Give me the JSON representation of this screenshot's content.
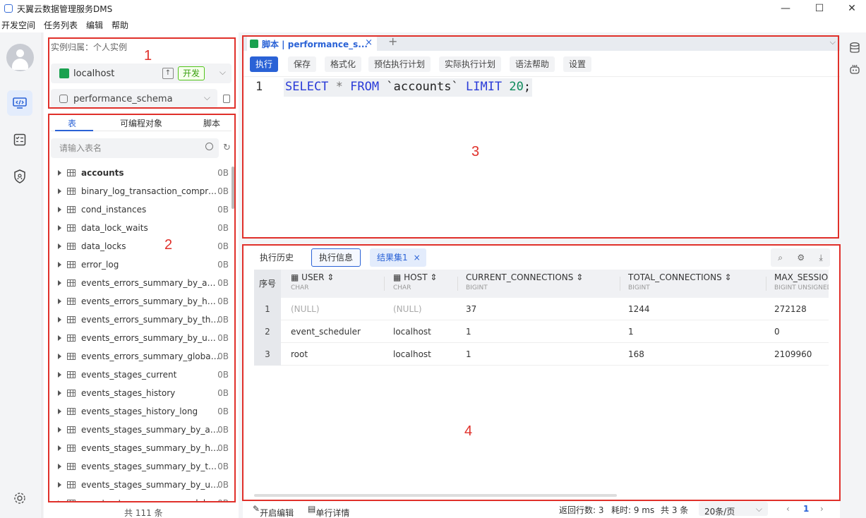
{
  "window": {
    "title": "天翼云数据管理服务DMS",
    "minimize": "—",
    "maximize": "☐",
    "close": "✕"
  },
  "menu": [
    "开发空间",
    "任务列表",
    "编辑",
    "帮助"
  ],
  "sidebar": {
    "instance_label": "实例归属：个人实例",
    "connection": {
      "name": "localhost",
      "env_tag": "开发"
    },
    "database": "performance_schema",
    "tabs": [
      "表",
      "可编程对象",
      "脚本"
    ],
    "active_tab": "表",
    "search_placeholder": "请输入表名",
    "tables": [
      {
        "name": "accounts",
        "size": "0B",
        "bold": true
      },
      {
        "name": "binary_log_transaction_compression_stats",
        "size": "0B"
      },
      {
        "name": "cond_instances",
        "size": "0B"
      },
      {
        "name": "data_lock_waits",
        "size": "0B"
      },
      {
        "name": "data_locks",
        "size": "0B"
      },
      {
        "name": "error_log",
        "size": "0B"
      },
      {
        "name": "events_errors_summary_by_account_by_error",
        "size": "0B"
      },
      {
        "name": "events_errors_summary_by_host_by_error",
        "size": "0B"
      },
      {
        "name": "events_errors_summary_by_thread_by_error",
        "size": "0B"
      },
      {
        "name": "events_errors_summary_by_user_by_error",
        "size": "0B"
      },
      {
        "name": "events_errors_summary_global_by_error",
        "size": "0B"
      },
      {
        "name": "events_stages_current",
        "size": "0B"
      },
      {
        "name": "events_stages_history",
        "size": "0B"
      },
      {
        "name": "events_stages_history_long",
        "size": "0B"
      },
      {
        "name": "events_stages_summary_by_account_by_event_name",
        "size": "0B"
      },
      {
        "name": "events_stages_summary_by_host_by_event_name",
        "size": "0B"
      },
      {
        "name": "events_stages_summary_by_thread_by_event_name",
        "size": "0B"
      },
      {
        "name": "events_stages_summary_by_user_by_event_name",
        "size": "0B"
      },
      {
        "name": "events_stages_summary_global_by_event_name",
        "size": "0B"
      }
    ],
    "total": "共 111 条"
  },
  "editor": {
    "tab_label": "脚本 | performance_s...",
    "toolbar": [
      "执行",
      "保存",
      "格式化",
      "预估执行计划",
      "实际执行计划",
      "语法帮助",
      "设置"
    ],
    "line_no": "1",
    "code": {
      "kw1": "SELECT",
      "star": "*",
      "kw2": "FROM",
      "table": "`accounts`",
      "kw3": "LIMIT",
      "num": "20",
      "end": ";"
    }
  },
  "results": {
    "tabs": [
      "执行历史",
      "执行信息",
      "结果集1"
    ],
    "seq_header": "序号",
    "columns": [
      {
        "name": "USER",
        "type": "CHAR"
      },
      {
        "name": "HOST",
        "type": "CHAR"
      },
      {
        "name": "CURRENT_CONNECTIONS",
        "type": "BIGINT"
      },
      {
        "name": "TOTAL_CONNECTIONS",
        "type": "BIGINT"
      },
      {
        "name": "MAX_SESSION",
        "type": "BIGINT UNSIGNED"
      }
    ],
    "rows": [
      {
        "idx": "1",
        "cells": [
          "(NULL)",
          "(NULL)",
          "37",
          "1244",
          "272128"
        ]
      },
      {
        "idx": "2",
        "cells": [
          "event_scheduler",
          "localhost",
          "1",
          "1",
          "0"
        ]
      },
      {
        "idx": "3",
        "cells": [
          "root",
          "localhost",
          "1",
          "168",
          "2109960"
        ]
      }
    ]
  },
  "status": {
    "open_edit": "开启编辑",
    "row_detail": "单行详情",
    "rows_returned": "返回行数: 3",
    "elapsed": "耗时: 9 ms",
    "total": "共 3 条",
    "page_size": "20条/页",
    "page": "1",
    "prev": "‹",
    "next": "›"
  },
  "annotations": [
    "1",
    "2",
    "3",
    "4"
  ],
  "colors": {
    "accent": "#2a62d6",
    "annotation": "#e0302a",
    "env_tag": "#52c41a"
  }
}
